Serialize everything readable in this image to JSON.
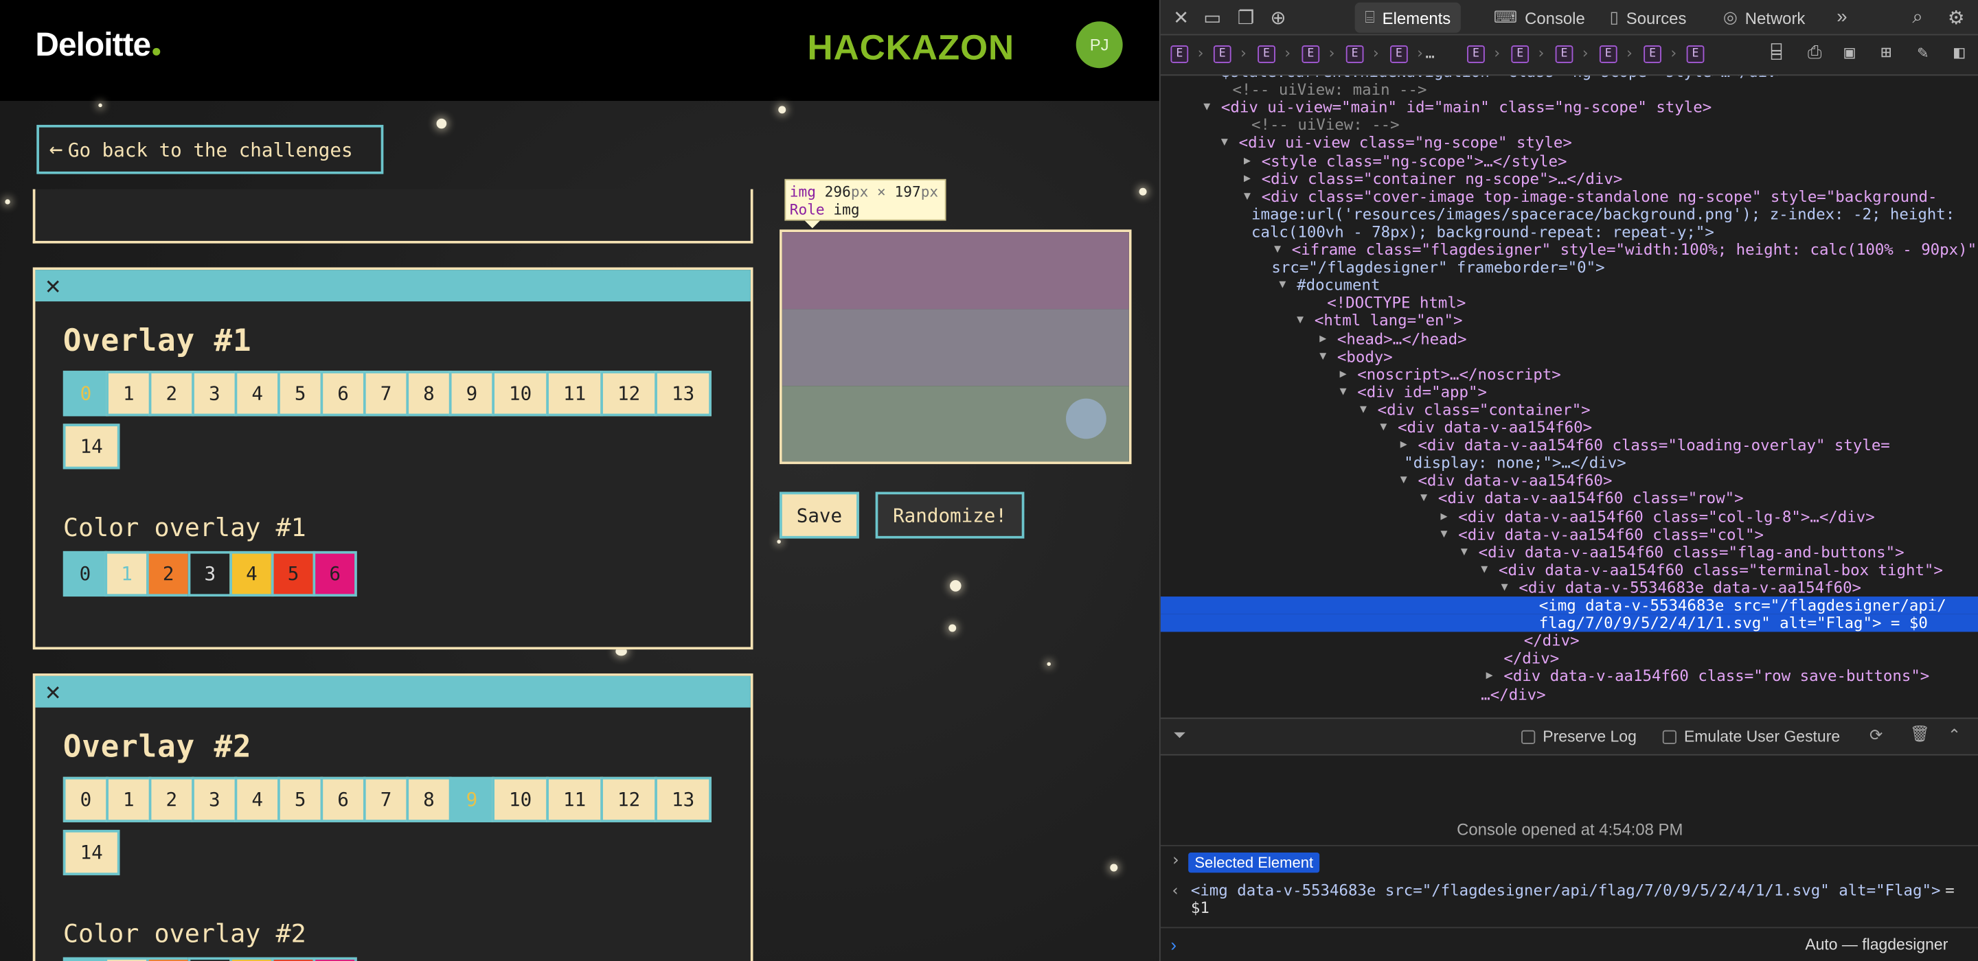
{
  "header": {
    "logo": "Deloitte",
    "brand": "HACKAZON",
    "avatar_initials": "PJ"
  },
  "back_button": {
    "label": "Go back to the challenges"
  },
  "overlay1": {
    "title": "Overlay #1",
    "options": [
      "0",
      "1",
      "2",
      "3",
      "4",
      "5",
      "6",
      "7",
      "8",
      "9",
      "10",
      "11",
      "12",
      "13",
      "14"
    ],
    "selected": "0",
    "color_title": "Color overlay #1",
    "colors": [
      "0",
      "1",
      "2",
      "3",
      "4",
      "5",
      "6"
    ]
  },
  "overlay2": {
    "title": "Overlay #2",
    "options": [
      "0",
      "1",
      "2",
      "3",
      "4",
      "5",
      "6",
      "7",
      "8",
      "9",
      "10",
      "11",
      "12",
      "13",
      "14"
    ],
    "selected": "9",
    "color_title": "Color overlay #2"
  },
  "color_swatches": [
    "#6cc5cc",
    "#f6e3b4",
    "#f07c2a",
    "#232323",
    "#f5c02c",
    "#ea3a1e",
    "#e0157a"
  ],
  "tooltip": {
    "tag": "img",
    "w": "296",
    "unit": "px",
    "x": "×",
    "h": "197",
    "role_label": "Role",
    "role_value": "img"
  },
  "flag_colors": [
    "#8c6e88",
    "#85808c",
    "#7e8d7e",
    "#93a8ba"
  ],
  "actions": {
    "save": "Save",
    "randomize": "Randomize!"
  },
  "devtools": {
    "tabs": {
      "elements": "Elements",
      "console": "Console",
      "sources": "Sources",
      "network": "Network"
    },
    "crumb_letter": "E",
    "crumb_ellipsis": "…",
    "dom": [
      {
        "t": "$state.current.hideNavigation\" class=\"ng-scope\" style>…</div>"
      },
      {
        "t": "<!-- uiView: main -->"
      },
      {
        "t": "<div ui-view=\"main\" id=\"main\" class=\"ng-scope\" style>"
      },
      {
        "t": "<!-- uiView: -->"
      },
      {
        "t": "<div ui-view class=\"ng-scope\" style>"
      },
      {
        "t": "<style class=\"ng-scope\">…</style>"
      },
      {
        "t": "<div class=\"container ng-scope\">…</div>"
      },
      {
        "t": "<div class=\"cover-image top-image-standalone ng-scope\" style=\"background-"
      },
      {
        "t": "image:url('resources/images/spacerace/background.png'); z-index: -2; height:"
      },
      {
        "t": "calc(100vh - 78px); background-repeat: repeat-y;\">"
      },
      {
        "t": "<iframe class=\"flagdesigner\" style=\"width:100%; height: calc(100% - 90px)\""
      },
      {
        "t": "src=\"/flagdesigner\" frameborder=\"0\">"
      },
      {
        "t": "#document"
      },
      {
        "t": "<!DOCTYPE html>"
      },
      {
        "t": "<html lang=\"en\">"
      },
      {
        "t": "<head>…</head>"
      },
      {
        "t": "<body>"
      },
      {
        "t": "<noscript>…</noscript>"
      },
      {
        "t": "<div id=\"app\">"
      },
      {
        "t": "<div class=\"container\">"
      },
      {
        "t": "<div data-v-aa154f60>"
      },
      {
        "t": "<div data-v-aa154f60 class=\"loading-overlay\" style="
      },
      {
        "t": "\"display: none;\">…</div>"
      },
      {
        "t": "<div data-v-aa154f60>"
      },
      {
        "t": "<div data-v-aa154f60 class=\"row\">"
      },
      {
        "t": "<div data-v-aa154f60 class=\"col-lg-8\">…</div>"
      },
      {
        "t": "<div data-v-aa154f60 class=\"col\">"
      },
      {
        "t": "<div data-v-aa154f60 class=\"flag-and-buttons\">"
      },
      {
        "t": "<div data-v-aa154f60 class=\"terminal-box tight\">"
      },
      {
        "t": "<div data-v-5534683e data-v-aa154f60>"
      },
      {
        "t": "<img data-v-5534683e src=\"/flagdesigner/api/"
      },
      {
        "t": "flag/7/0/9/5/2/4/1/1.svg\" alt=\"Flag\"> = $0"
      },
      {
        "t": "</div>"
      },
      {
        "t": "</div>"
      },
      {
        "t": "<div data-v-aa154f60 class=\"row save-buttons\">"
      },
      {
        "t": "…</div>"
      }
    ],
    "console": {
      "preserve_log": "Preserve Log",
      "emulate_gesture": "Emulate User Gesture",
      "opened_msg": "Console opened at 4:54:08 PM",
      "selected_element": "Selected Element",
      "result_line1": "<img data-v-5534683e src=\"/flagdesigner/api/flag/7/0/9/5/2/4/1/1.svg\" alt=\"Flag\">",
      "result_eq": "=",
      "result_line2": "$1",
      "context": "Auto — flagdesigner"
    }
  }
}
